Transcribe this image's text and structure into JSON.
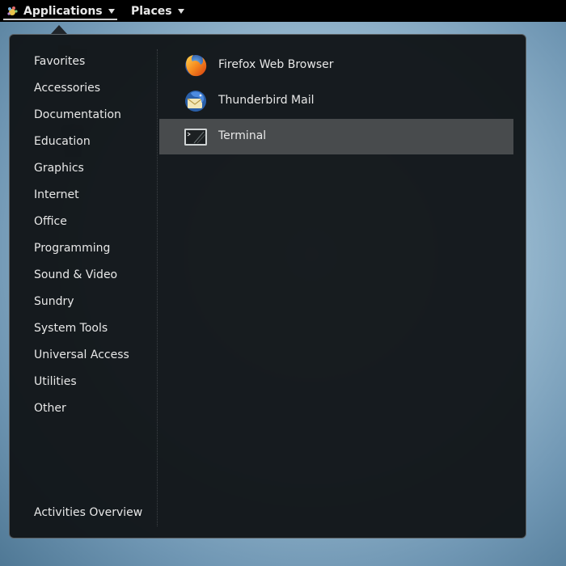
{
  "topbar": {
    "applications_label": "Applications",
    "places_label": "Places"
  },
  "menu": {
    "categories": [
      "Favorites",
      "Accessories",
      "Documentation",
      "Education",
      "Graphics",
      "Internet",
      "Office",
      "Programming",
      "Sound & Video",
      "Sundry",
      "System Tools",
      "Universal Access",
      "Utilities",
      "Other"
    ],
    "activities_label": "Activities Overview",
    "apps": [
      {
        "label": "Firefox Web Browser",
        "icon": "firefox-icon"
      },
      {
        "label": "Thunderbird Mail",
        "icon": "thunderbird-icon"
      },
      {
        "label": "Terminal",
        "icon": "terminal-icon",
        "selected": true
      }
    ]
  }
}
